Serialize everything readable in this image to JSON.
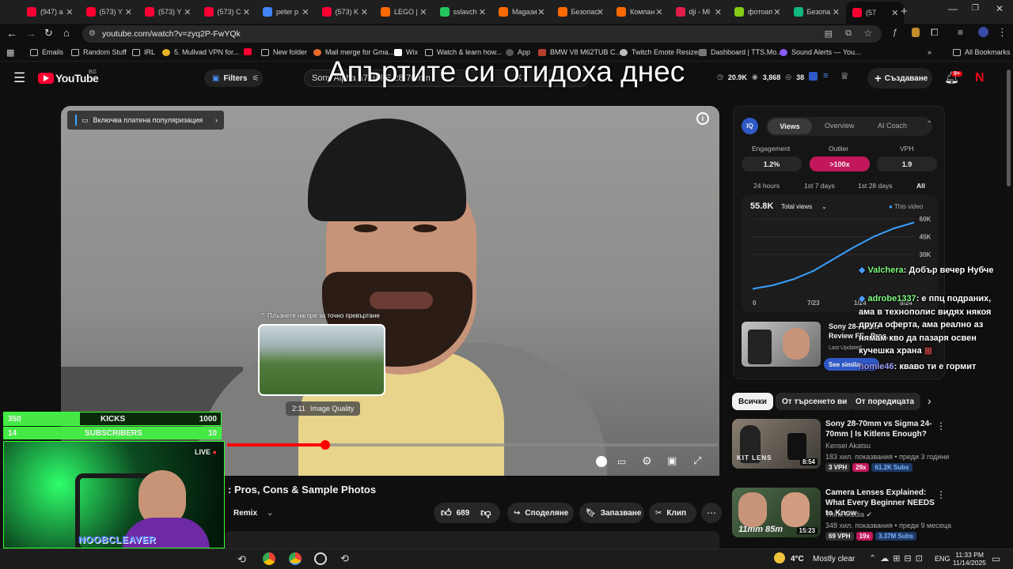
{
  "tabs": [
    {
      "label": "(947) a",
      "color": "#ff0033"
    },
    {
      "label": "(573) Y",
      "color": "#ff0033"
    },
    {
      "label": "(573) Y",
      "color": "#ff0033"
    },
    {
      "label": "(573) C",
      "color": "#ff0033"
    },
    {
      "label": "peter p",
      "color": "#4285f4"
    },
    {
      "label": "(573) K",
      "color": "#ff0033"
    },
    {
      "label": "LEGO |",
      "color": "#ff6a00"
    },
    {
      "label": "sslavch",
      "color": "#22c55e"
    },
    {
      "label": "Magaзи",
      "color": "#ff6a00"
    },
    {
      "label": "Безопас",
      "color": "#ff6a00"
    },
    {
      "label": "Компан",
      "color": "#ff6a00"
    },
    {
      "label": "dji - Ml",
      "color": "#e11d48"
    },
    {
      "label": "фотоап",
      "color": "#84cc16"
    },
    {
      "label": "Безопа",
      "color": "#10b981"
    },
    {
      "label": "(57",
      "color": "#ff0033"
    }
  ],
  "address": {
    "url": "youtube.com/watch?v=zyq2P-FwYQk"
  },
  "bookmarks": [
    "Emails",
    "Random Stuff",
    "IRL",
    "5. Mullvad VPN for...",
    "New folder",
    "Mail merge for Gma...",
    "Wix",
    "Watch & learn how...",
    "App",
    "BMW V8 M62TUB C...",
    "Twitch Emote Resizer",
    "Dashboard | TTS.Mo...",
    "Sound Alerts — You...",
    "All Bookmarks"
  ],
  "yt": {
    "logo": "YouTube",
    "region": "BG",
    "filters": "Filters",
    "search_value": "Sony Alpha a7 III FE 28-70mm",
    "stat_views": "20.9K",
    "stat_b": "3,868",
    "stat_c": "38",
    "create": "Създаване",
    "notif": "9+"
  },
  "overlay_title": "Апъртите си отидоха днес",
  "video": {
    "promo": "Включва платена популяризация",
    "seek_hint": "Плъзнете нагоре за точно превъртане",
    "preview_time": "2:11",
    "preview_chapter": "Image Quality",
    "progress": 0.2
  },
  "below_video": {
    "title_frag": ": Pros, Cons & Sample Photos",
    "remix": "Remix",
    "likes": "689",
    "share": "Споделяне",
    "save": "Запазване",
    "clip": "Клип"
  },
  "stream": {
    "kicks_current": "350",
    "kicks_label": "KICKS",
    "kicks_goal": "1000",
    "subs_current": "14",
    "subs_label": "SUBSCRIBERS",
    "subs_goal": "10",
    "live": "LIVE",
    "streamer": "NOOBCLEAVER"
  },
  "vidiq": {
    "logo": "IQ",
    "tabs": [
      "Views",
      "Overview",
      "AI Coach"
    ],
    "metrics": [
      {
        "label": "Engagement",
        "value": "1.2%"
      },
      {
        "label": "Outlier",
        "value": ">100x"
      },
      {
        "label": "VPH",
        "value": "1.9"
      }
    ],
    "ranges": [
      "24 hours",
      "1st 7 days",
      "1st 28 days",
      "All"
    ],
    "total": "55.8K",
    "total_label": "Total views",
    "legend": "This video",
    "y_ticks": [
      "60K",
      "45K",
      "30K"
    ],
    "x_ticks": [
      "0",
      "7/23",
      "1/24",
      "8/24"
    ],
    "related_title": "Sony 28-70mm Review FE - Pros, Cons &...",
    "related_sub": "Last Updated",
    "see_similar": "See similar"
  },
  "chart_data": {
    "type": "line",
    "x": [
      "0",
      "7/23",
      "1/24",
      "8/24",
      "",
      "",
      "",
      "",
      ""
    ],
    "series": [
      {
        "name": "This video",
        "values": [
          1,
          4,
          9,
          16,
          26,
          36,
          45,
          52,
          57
        ]
      }
    ],
    "ylim": [
      0,
      60
    ],
    "title": "",
    "xlabel": "",
    "ylabel": ""
  },
  "chat": [
    {
      "user": "Valchera",
      "user_color": "#7fff7f",
      "text": ": Добър вечер Нубче"
    },
    {
      "user": "adrobe1337",
      "user_color": "#7fff7f",
      "text": ": е ппц подраних, ама в технополис видях някоя друга оферта, ама реално аз нямам кво да пазаря освен кучешка храна"
    },
    {
      "user": "homie46",
      "user_color": "#a0a0ff",
      "text": ": кваво ти е гормит"
    }
  ],
  "filter_chips": [
    "Всички",
    "От търсенето ви",
    "От поредицата"
  ],
  "recommended": [
    {
      "title": "Sony 28-70mm vs Sigma 24-70mm | Is Kitlens Enough?",
      "channel": "Kensei Akatsu",
      "meta": "183 хил. показвания • преди 3 години",
      "duration": "8:54",
      "vph": "3 VPH",
      "outlier": "29x",
      "subs": "61.2K Subs",
      "thumb_text": "KIT LENS"
    },
    {
      "title": "Camera Lenses Explained: What Every Beginner NEEDS to Know",
      "channel": "Think Media",
      "meta": "348 хил. показвания • преди 9 месеца",
      "duration": "15:23",
      "vph": "69 VPH",
      "outlier": "19x",
      "subs": "3.37M Subs",
      "thumb_text": "11mm 85m"
    }
  ],
  "taskbar": {
    "temp": "4°C",
    "weather": "Mostly clear",
    "lang": "ENG",
    "time": "11:33 PM",
    "date": "11/14/2025"
  }
}
